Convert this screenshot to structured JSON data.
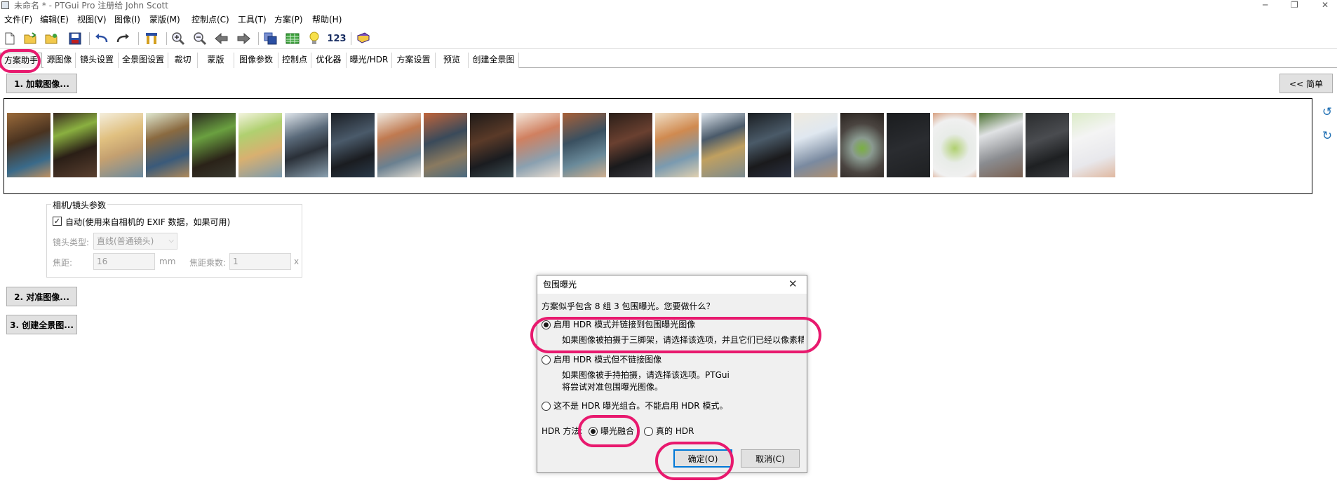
{
  "window": {
    "title": "未命名 * - PTGui Pro 注册给 John Scott",
    "minimize": "─",
    "restore": "❐",
    "close": "✕"
  },
  "menu": [
    "文件(F)",
    "编辑(E)",
    "视图(V)",
    "图像(I)",
    "蒙版(M)",
    "控制点(C)",
    "工具(T)",
    "方案(P)",
    "帮助(H)"
  ],
  "toolbar": {
    "icons": [
      "new-file-icon",
      "open-folder-icon",
      "open-recent-icon",
      "save-icon",
      "undo-icon",
      "redo-icon",
      "tools-icon",
      "zoom-in-icon",
      "zoom-out-icon",
      "back-arrow-icon",
      "forward-arrow-icon",
      "stack-images-icon",
      "table-icon",
      "lightbulb-icon",
      "numbering-icon",
      "book-icon"
    ],
    "numbering_label": "123"
  },
  "tabs": [
    "方案助手",
    "源图像",
    "镜头设置",
    "全景图设置",
    "裁切",
    "蒙版",
    "图像参数",
    "控制点",
    "优化器",
    "曝光/HDR",
    "方案设置",
    "预览",
    "创建全景图"
  ],
  "assistant": {
    "load_button": "1. 加载图像...",
    "simple_button": "<< 简单",
    "align_button": "2. 对准图像...",
    "create_button": "3. 创建全景图..."
  },
  "camera": {
    "group_title": "相机/镜头参数",
    "auto_checkbox_label": "自动(使用来自相机的 EXIF 数据，如果可用)",
    "auto_checked": true,
    "lens_type_label": "镜头类型:",
    "lens_type_value": "直线(普通镜头)",
    "focal_length_label": "焦距:",
    "focal_length_value": "16",
    "focal_unit": "mm",
    "multiplier_label": "焦距乘数:",
    "multiplier_value": "1",
    "multiplier_suffix": "x"
  },
  "dialog": {
    "title": "包围曝光",
    "close": "✕",
    "question": "方案似乎包含 8 组 3 包围曝光。您要做什么？",
    "option1_label": "启用 HDR 模式并链接到包围曝光图像",
    "option1_desc": "如果图像被拍摄于三脚架，请选择该选项，并且它们已经以像素精",
    "option2_label": "启用 HDR 模式但不链接图像",
    "option2_desc_line1": "如果图像被手持拍摄，请选择该选项。PTGui",
    "option2_desc_line2": "将尝试对准包围曝光图像。",
    "option3_label": "这不是 HDR 曝光组合。不能启用 HDR 模式。",
    "selected_option": 1,
    "hdr_method_label": "HDR 方法:",
    "method1_label": "曝光融合",
    "method2_label": "真的 HDR",
    "selected_method": 1,
    "ok_button": "确定(O)",
    "cancel_button": "取消(C)"
  },
  "colors": {
    "highlight": "#e8196e",
    "default_button_border": "#0078d7",
    "tab_border": "#b0b0b0"
  }
}
